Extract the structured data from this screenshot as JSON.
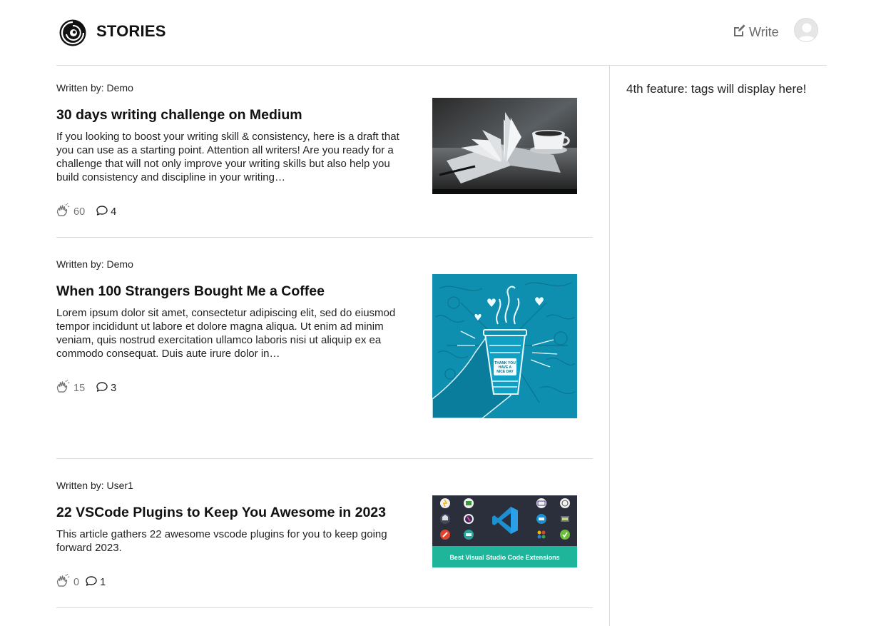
{
  "header": {
    "brand": "STORIES",
    "logo_icon": "spiral-logo-icon",
    "write_label": "Write",
    "write_icon": "pencil-square-icon",
    "avatar_icon": "user-avatar-icon"
  },
  "sidebar": {
    "text": "4th feature: tags will display here!"
  },
  "posts": [
    {
      "author": "Written by: Demo",
      "title": "30 days writing challenge on Medium",
      "excerpt": "If you looking to boost your writing skill & consistency, here is a draft that you can use as a starting point. Attention all writers! Are you ready for a challenge that will not only improve your writing skills but also help you build consistency and discipline in your writing…",
      "claps": "60",
      "comments": "4",
      "image": "open-book-and-coffee-cup-photo"
    },
    {
      "author": "Written by: Demo",
      "title": "When 100 Strangers Bought Me a Coffee",
      "excerpt": "Lorem ipsum dolor sit amet, consectetur adipiscing elit, sed do eiusmod tempor incididunt ut labore et dolore magna aliqua. Ut enim ad minim veniam, quis nostrud exercitation ullamco laboris nisi ut aliquip ex ea commodo consequat. Duis aute irure dolor in…",
      "claps": "15",
      "comments": "3",
      "image": "hand-holding-coffee-cup-illustration",
      "cup_text_line1": "THANK YOU",
      "cup_text_line2": "HAVE A",
      "cup_text_line3": "NICE DAY"
    },
    {
      "author": "Written by: User1",
      "title": "22 VSCode Plugins to Keep You Awesome in 2023",
      "excerpt": "This article gathers 22 awesome vscode plugins for you to keep going forward 2023.",
      "claps": "0",
      "comments": "1",
      "image": "vscode-extensions-banner",
      "banner_text": "Best Visual Studio Code Extensions"
    }
  ],
  "colors": {
    "muted_text": "#757575",
    "divider": "#d9d9d9",
    "banner_green": "#1fb59b",
    "coffee_blue": "#0e8fb0"
  }
}
